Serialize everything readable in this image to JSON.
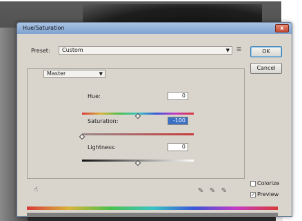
{
  "dialog": {
    "title": "Hue/Saturation",
    "close_label": "x",
    "preset_label": "Preset:",
    "preset_value": "Custom",
    "ok_label": "OK",
    "cancel_label": "Cancel",
    "edit_value": "Master",
    "hue_label": "Hue:",
    "hue_value": "0",
    "saturation_label": "Saturation:",
    "saturation_value": "-100",
    "lightness_label": "Lightness:",
    "lightness_value": "0",
    "colorize_label": "Colorize",
    "preview_label": "Preview",
    "preset_menu_icon": "menu-list-icon",
    "caret_glyph": "▼",
    "check_glyph": "✓"
  },
  "sliders": {
    "hue_fraction": 0.5,
    "saturation_fraction": 0.0,
    "lightness_fraction": 0.5
  },
  "colors": {
    "accent": "#3a6fc4",
    "titlebar": "#8fb0da"
  }
}
